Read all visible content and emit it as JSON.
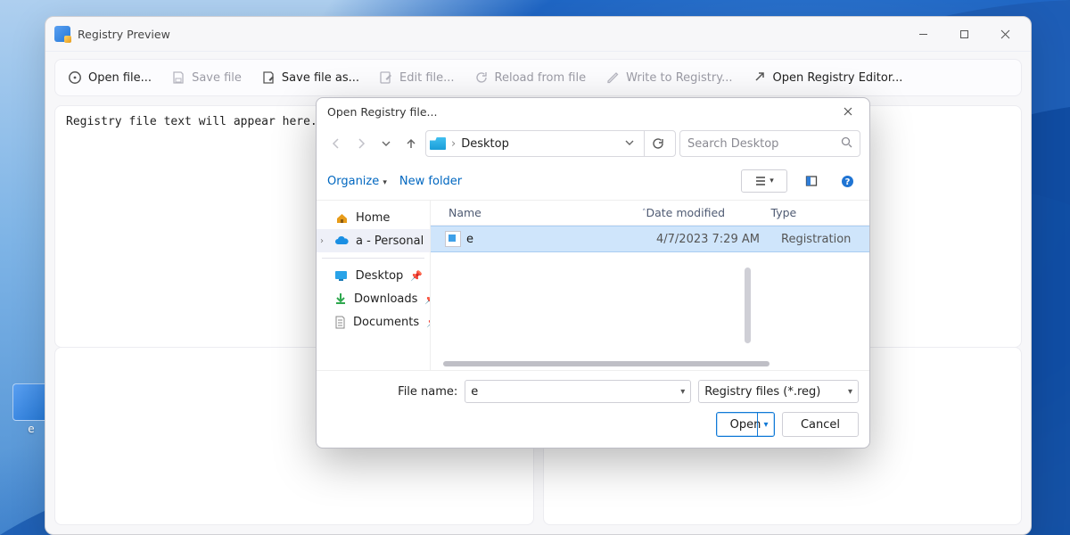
{
  "window": {
    "title": "Registry Preview",
    "toolbar": {
      "open": "Open file...",
      "save": "Save file",
      "save_as": "Save file as...",
      "edit": "Edit file...",
      "reload": "Reload from file",
      "write": "Write to Registry...",
      "open_editor": "Open Registry Editor..."
    },
    "body_text": "Registry file text will appear here."
  },
  "desktop_icon": {
    "label": "e"
  },
  "dialog": {
    "title": "Open Registry file...",
    "location": "Desktop",
    "search_placeholder": "Search Desktop",
    "organize": "Organize",
    "new_folder": "New folder",
    "sidebar": {
      "home": "Home",
      "personal": "a - Personal",
      "desktop": "Desktop",
      "downloads": "Downloads",
      "documents": "Documents"
    },
    "columns": {
      "name": "Name",
      "date": "Date modified",
      "type": "Type"
    },
    "rows": [
      {
        "name": "e",
        "date": "4/7/2023 7:29 AM",
        "type": "Registration"
      }
    ],
    "filename_label": "File name:",
    "filename_value": "e",
    "filetype_value": "Registry files (*.reg)",
    "open": "Open",
    "cancel": "Cancel"
  }
}
